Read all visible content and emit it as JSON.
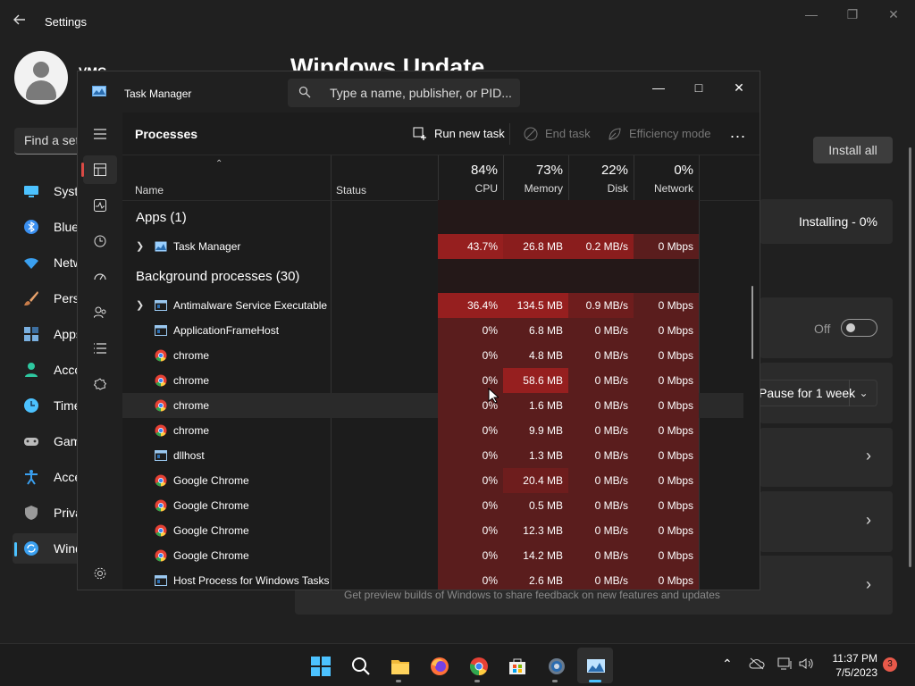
{
  "settings": {
    "title": "Settings",
    "user": "VMC",
    "find_placeholder": "Find a setting",
    "heading": "Windows Update",
    "nav": [
      {
        "label": "System",
        "icon": "monitor-icon",
        "color": "#4cc2ff"
      },
      {
        "label": "Bluetooth & devices",
        "icon": "bluetooth-icon",
        "color": "#3a8ff0"
      },
      {
        "label": "Network & internet",
        "icon": "wifi-icon",
        "color": "#3aa0f0"
      },
      {
        "label": "Personalization",
        "icon": "brush-icon",
        "color": "#e8a26b"
      },
      {
        "label": "Apps",
        "icon": "apps-icon",
        "color": "#7ab0e0"
      },
      {
        "label": "Accounts",
        "icon": "person-icon",
        "color": "#2ec8a0"
      },
      {
        "label": "Time & language",
        "icon": "globe-clock-icon",
        "color": "#4cc2ff"
      },
      {
        "label": "Gaming",
        "icon": "controller-icon",
        "color": "#bbbbbb"
      },
      {
        "label": "Accessibility",
        "icon": "accessibility-icon",
        "color": "#3aa0f0"
      },
      {
        "label": "Privacy & security",
        "icon": "shield-icon",
        "color": "#9a9a9a"
      },
      {
        "label": "Windows Update",
        "icon": "update-icon",
        "color": "#3aa0f0"
      }
    ],
    "install_all": "Install all",
    "installing": "Installing - 0%",
    "toggle_label": "Off",
    "pause_label": "Pause for 1 week",
    "insider_text": "Get preview builds of Windows to share feedback on new features and updates"
  },
  "task_manager": {
    "title": "Task Manager",
    "search_placeholder": "Type a name, publisher, or PID...",
    "section": "Processes",
    "commands": {
      "run_new_task": "Run new task",
      "end_task": "End task",
      "efficiency_mode": "Efficiency mode",
      "more": "..."
    },
    "columns": {
      "name": "Name",
      "status": "Status",
      "cpu": {
        "percent": "84%",
        "label": "CPU"
      },
      "memory": {
        "percent": "73%",
        "label": "Memory"
      },
      "disk": {
        "percent": "22%",
        "label": "Disk"
      },
      "network": {
        "percent": "0%",
        "label": "Network"
      }
    },
    "groups": {
      "apps": "Apps (1)",
      "background": "Background processes (30)"
    },
    "apps": [
      {
        "name": "Task Manager",
        "icon": "task-manager-icon",
        "cpu": "43.7%",
        "memory": "26.8 MB",
        "disk": "0.2 MB/s",
        "network": "0 Mbps"
      }
    ],
    "processes": [
      {
        "name": "Antimalware Service Executable",
        "icon": "service-icon",
        "expandable": true,
        "cpu": "36.4%",
        "memory": "134.5 MB",
        "disk": "0.9 MB/s",
        "network": "0 Mbps"
      },
      {
        "name": "ApplicationFrameHost",
        "icon": "service-icon",
        "cpu": "0%",
        "memory": "6.8 MB",
        "disk": "0 MB/s",
        "network": "0 Mbps"
      },
      {
        "name": "chrome",
        "icon": "chrome-icon",
        "cpu": "0%",
        "memory": "4.8 MB",
        "disk": "0 MB/s",
        "network": "0 Mbps"
      },
      {
        "name": "chrome",
        "icon": "chrome-icon",
        "cpu": "0%",
        "memory": "58.6 MB",
        "disk": "0 MB/s",
        "network": "0 Mbps"
      },
      {
        "name": "chrome",
        "icon": "chrome-icon",
        "cpu": "0%",
        "memory": "1.6 MB",
        "disk": "0 MB/s",
        "network": "0 Mbps"
      },
      {
        "name": "chrome",
        "icon": "chrome-icon",
        "cpu": "0%",
        "memory": "9.9 MB",
        "disk": "0 MB/s",
        "network": "0 Mbps"
      },
      {
        "name": "dllhost",
        "icon": "service-icon",
        "cpu": "0%",
        "memory": "1.3 MB",
        "disk": "0 MB/s",
        "network": "0 Mbps"
      },
      {
        "name": "Google Chrome",
        "icon": "chrome-icon",
        "cpu": "0%",
        "memory": "20.4 MB",
        "disk": "0 MB/s",
        "network": "0 Mbps"
      },
      {
        "name": "Google Chrome",
        "icon": "chrome-icon",
        "cpu": "0%",
        "memory": "0.5 MB",
        "disk": "0 MB/s",
        "network": "0 Mbps"
      },
      {
        "name": "Google Chrome",
        "icon": "chrome-icon",
        "cpu": "0%",
        "memory": "12.3 MB",
        "disk": "0 MB/s",
        "network": "0 Mbps"
      },
      {
        "name": "Google Chrome",
        "icon": "chrome-icon",
        "cpu": "0%",
        "memory": "14.2 MB",
        "disk": "0 MB/s",
        "network": "0 Mbps"
      },
      {
        "name": "Host Process for Windows Tasks",
        "icon": "service-icon",
        "cpu": "0%",
        "memory": "2.6 MB",
        "disk": "0 MB/s",
        "network": "0 Mbps"
      }
    ]
  },
  "taskbar": {
    "apps": [
      {
        "icon": "windows-start-icon"
      },
      {
        "icon": "search-icon"
      },
      {
        "icon": "file-explorer-icon"
      },
      {
        "icon": "firefox-icon"
      },
      {
        "icon": "chrome-icon"
      },
      {
        "icon": "microsoft-store-icon"
      },
      {
        "icon": "settings-icon"
      },
      {
        "icon": "task-manager-icon"
      }
    ],
    "time": "11:37 PM",
    "date": "7/5/2023",
    "notifications": "3"
  },
  "colors": {
    "accent": "#4cc2ff",
    "heat_high": "#961f1f",
    "heat_low": "#5a1d1d",
    "selection_marker": "#d94a45"
  }
}
